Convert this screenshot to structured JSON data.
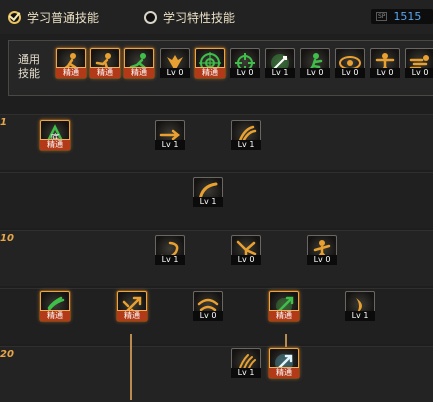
{
  "header": {
    "option_normal": "学习普通技能",
    "option_trait": "学习特性技能",
    "sp_tag": "SP",
    "sp_value": "1515"
  },
  "general_skills": {
    "label": "通用技能",
    "items": [
      {
        "badge": "精通",
        "type": "mastery",
        "icon": "runner-icon",
        "color": "#e8a030"
      },
      {
        "badge": "精通",
        "type": "mastery",
        "icon": "jump-icon",
        "color": "#e8a030"
      },
      {
        "badge": "精通",
        "type": "mastery",
        "icon": "leap-icon",
        "color": "#3fbf4a"
      },
      {
        "badge": "Lv 0",
        "type": "level",
        "icon": "wings-icon",
        "color": "#e8a030"
      },
      {
        "badge": "精通",
        "type": "mastery",
        "icon": "target-icon",
        "color": "#3fbf4a"
      },
      {
        "badge": "Lv 0",
        "type": "level",
        "icon": "crosshair-icon",
        "color": "#3fbf4a"
      },
      {
        "badge": "Lv 1",
        "type": "level",
        "icon": "sword-glow-icon",
        "color": "#3fbf4a"
      },
      {
        "badge": "Lv 0",
        "type": "level",
        "icon": "kneel-icon",
        "color": "#3fbf4a"
      },
      {
        "badge": "Lv 0",
        "type": "level",
        "icon": "eye-icon",
        "color": "#e8a030"
      },
      {
        "badge": "Lv 0",
        "type": "level",
        "icon": "warrior-icon",
        "color": "#e8a030"
      },
      {
        "badge": "Lv 0",
        "type": "level",
        "icon": "dash-icon",
        "color": "#e8a030"
      }
    ]
  },
  "tree_rows": [
    {
      "level": "1",
      "show_level": true
    },
    {
      "level": "",
      "show_level": false
    },
    {
      "level": "10",
      "show_level": true
    },
    {
      "level": "",
      "show_level": false
    },
    {
      "level": "20",
      "show_level": true
    }
  ],
  "tree_skills": [
    {
      "badge": "精通",
      "type": "mastery",
      "icon": "base-stance-icon",
      "color": "#3fbf4a"
    },
    {
      "badge": "Lv 1",
      "type": "level",
      "icon": "thrust-icon",
      "color": "#e8a030"
    },
    {
      "badge": "Lv 1",
      "type": "level",
      "icon": "claw-slash-icon",
      "color": "#e8a030"
    },
    {
      "badge": "Lv 1",
      "type": "level",
      "icon": "arc-slash-icon",
      "color": "#e8a030"
    },
    {
      "badge": "Lv 1",
      "type": "level",
      "icon": "spiral-slash-icon",
      "color": "#e8a030"
    },
    {
      "badge": "Lv 0",
      "type": "level",
      "icon": "burst-slash-icon",
      "color": "#e8a030"
    },
    {
      "badge": "Lv 0",
      "type": "level",
      "icon": "fighter-icon",
      "color": "#e8a030"
    },
    {
      "badge": "精通",
      "type": "mastery",
      "icon": "wind-slash-icon",
      "color": "#3fbf4a"
    },
    {
      "badge": "精通",
      "type": "mastery",
      "icon": "blade-burst-icon",
      "color": "#e8a030"
    },
    {
      "badge": "Lv 0",
      "type": "level",
      "icon": "whirl-slash-icon",
      "color": "#e8a030"
    },
    {
      "badge": "精通",
      "type": "mastery",
      "icon": "green-blade-icon",
      "color": "#3fbf4a"
    },
    {
      "badge": "Lv 1",
      "type": "level",
      "icon": "crescent-icon",
      "color": "#e8a030"
    },
    {
      "badge": "Lv 1",
      "type": "level",
      "icon": "triple-claw-icon",
      "color": "#e8a030"
    },
    {
      "badge": "精通",
      "type": "mastery",
      "icon": "ice-blade-icon",
      "color": "#5bc8e8"
    }
  ]
}
